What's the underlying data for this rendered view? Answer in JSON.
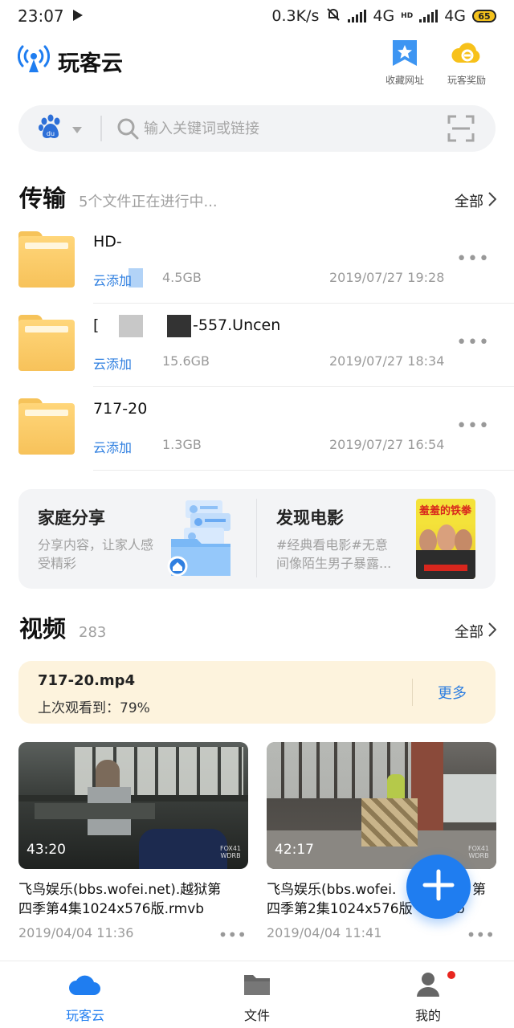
{
  "status_bar": {
    "time": "23:07",
    "net_speed": "0.3K/s",
    "network_1": "4G",
    "hd": "HD",
    "network_2": "4G",
    "battery": "65"
  },
  "header": {
    "app_name": "玩客云",
    "bookmarks_label": "收藏网址",
    "rewards_label": "玩客奖励"
  },
  "search": {
    "placeholder": "输入关键词或链接",
    "engine_text": "du"
  },
  "transfer": {
    "title": "传输",
    "subtitle": "5个文件正在进行中...",
    "all_label": "全部",
    "items": [
      {
        "name": "HD-",
        "tag": "云添加",
        "size": "4.5GB",
        "date": "2019/07/27 19:28"
      },
      {
        "name": "[",
        "name_tail": "-557.Uncen",
        "tag": "云添加",
        "size": "15.6GB",
        "date": "2019/07/27 18:34"
      },
      {
        "name": "717-20",
        "tag": "云添加",
        "size": "1.3GB",
        "date": "2019/07/27 16:54"
      }
    ]
  },
  "cards": {
    "family": {
      "title": "家庭分享",
      "desc_line1": "分享内容，让家人感",
      "desc_line2": "受精彩"
    },
    "movie": {
      "title": "发现电影",
      "desc_line1": "#经典看电影#无意",
      "desc_line2": "间像陌生男子暴露...",
      "poster_text": "羞羞的铁拳"
    }
  },
  "videos": {
    "title": "视频",
    "count": "283",
    "all_label": "全部",
    "continue": {
      "file": "717-20.mp4",
      "progress_text": "上次观看到：79%",
      "progress": 0.79,
      "more_label": "更多"
    },
    "items": [
      {
        "duration": "43:20",
        "title_line1": "飞鸟娱乐(bbs.wofei.net).越狱第",
        "title_line2": "四季第4集1024x576版.rmvb",
        "date": "2019/04/04 11:36",
        "watermark": "FOX41 WDRB"
      },
      {
        "duration": "42:17",
        "title_line1": "飞鸟娱乐(bbs.wofei.",
        "title_line1_tail": "第",
        "title_line2": "四季第2集1024x576版",
        "title_line2_tail": "b",
        "date": "2019/04/04 11:41",
        "watermark": "FOX41 WDRB"
      }
    ]
  },
  "bottom_nav": {
    "items": [
      {
        "label": "玩客云",
        "active": true
      },
      {
        "label": "文件",
        "active": false
      },
      {
        "label": "我的",
        "active": false
      }
    ]
  },
  "colors": {
    "accent": "#1f7df0",
    "folder": "#f7c25a",
    "continue_bg": "#fdf3dd",
    "badge": "#e8261f"
  }
}
